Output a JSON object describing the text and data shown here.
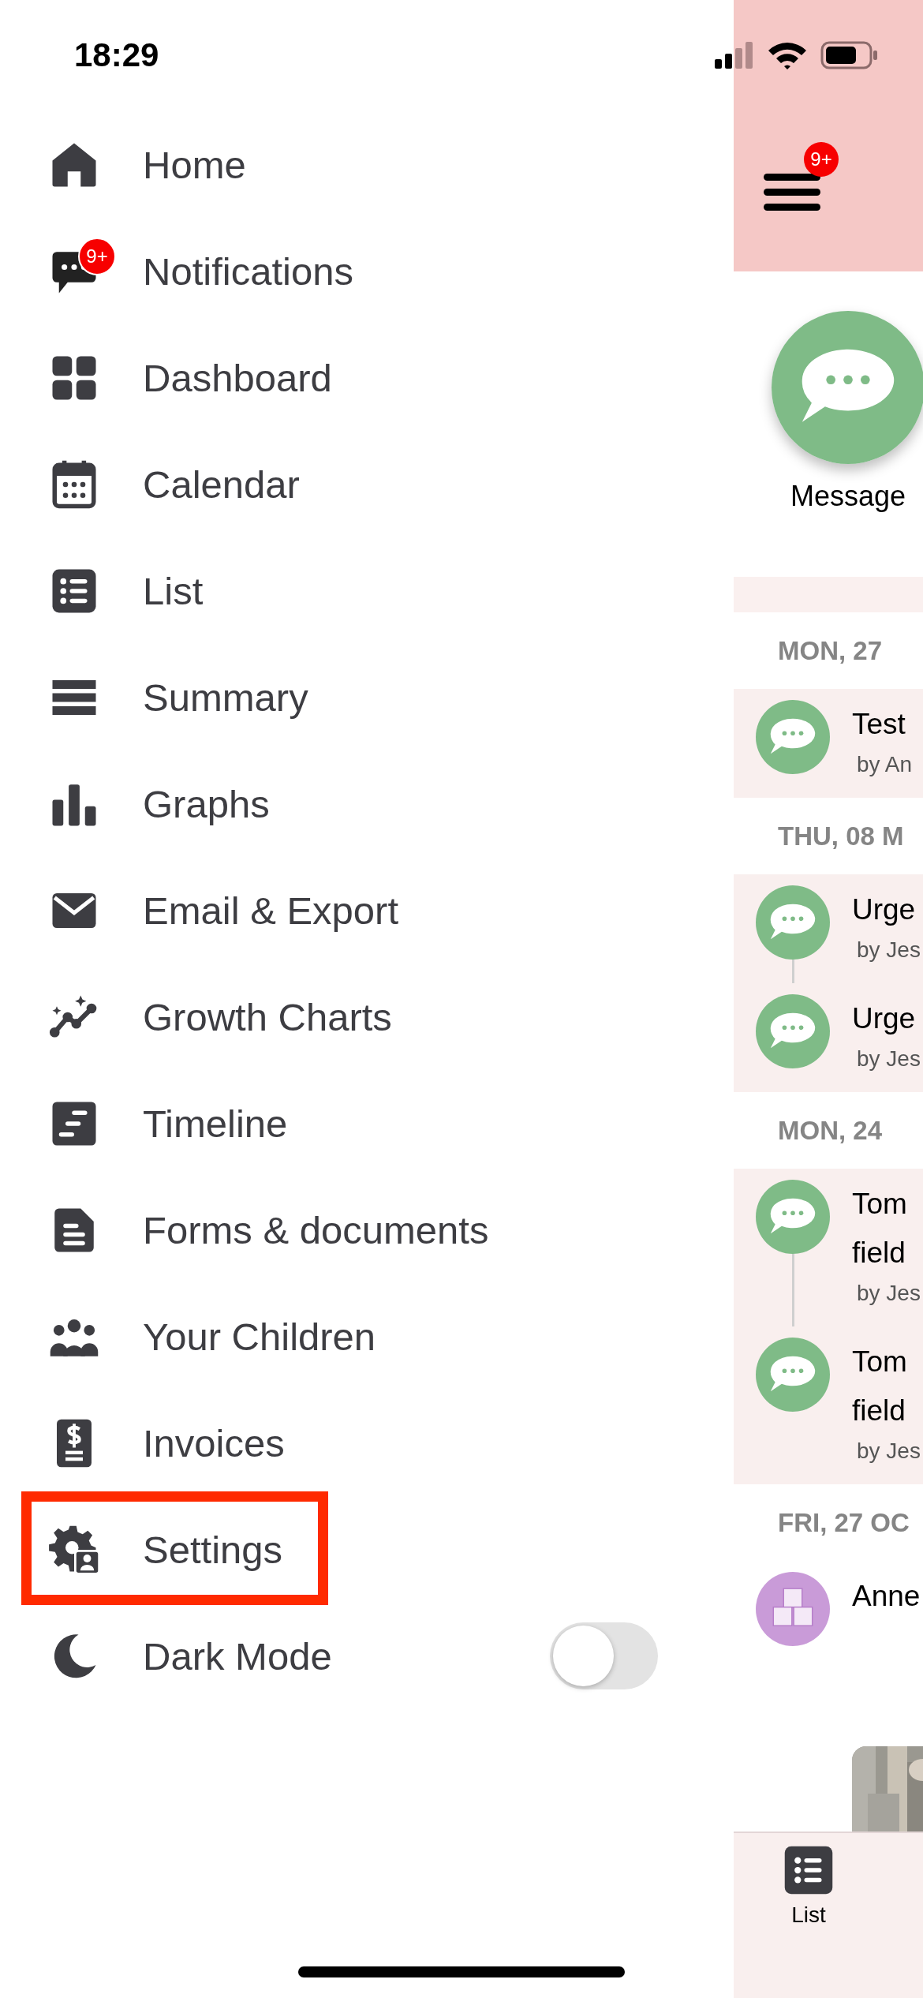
{
  "status_bar": {
    "time": "18:29"
  },
  "drawer": {
    "items": [
      {
        "kind": "home",
        "label": "Home",
        "annotated": false
      },
      {
        "kind": "chat",
        "label": "Notifications",
        "badge": "9+",
        "annotated": false
      },
      {
        "kind": "grid",
        "label": "Dashboard",
        "annotated": false
      },
      {
        "kind": "calendar",
        "label": "Calendar",
        "annotated": false
      },
      {
        "kind": "list",
        "label": "List",
        "annotated": false
      },
      {
        "kind": "summary",
        "label": "Summary",
        "annotated": false
      },
      {
        "kind": "graphs",
        "label": "Graphs",
        "annotated": false
      },
      {
        "kind": "mail",
        "label": "Email & Export",
        "annotated": false
      },
      {
        "kind": "growth",
        "label": "Growth Charts",
        "annotated": false
      },
      {
        "kind": "timeline",
        "label": "Timeline",
        "annotated": false
      },
      {
        "kind": "document",
        "label": "Forms & documents",
        "annotated": false
      },
      {
        "kind": "people",
        "label": "Your Children",
        "annotated": false
      },
      {
        "kind": "invoice",
        "label": "Invoices",
        "annotated": false
      },
      {
        "kind": "settings",
        "label": "Settings",
        "annotated": true
      }
    ],
    "dark_mode": {
      "label": "Dark Mode",
      "on": false
    }
  },
  "main": {
    "menu_badge": "9+",
    "action": {
      "label": "Message"
    },
    "feed": [
      {
        "date": "MON, 27",
        "shaded": true,
        "entries": [
          {
            "kind": "message",
            "title_lines": [
              "Test"
            ],
            "byline": "by An"
          }
        ]
      },
      {
        "date": "THU, 08 M",
        "shaded": true,
        "entries": [
          {
            "kind": "message",
            "title_lines": [
              "Urge"
            ],
            "byline": "by Jes"
          },
          {
            "kind": "message",
            "title_lines": [
              "Urge"
            ],
            "byline": "by Jes"
          }
        ]
      },
      {
        "date": "MON, 24",
        "shaded": true,
        "entries": [
          {
            "kind": "message",
            "title_lines": [
              "Tom",
              "field"
            ],
            "byline": "by Jes"
          },
          {
            "kind": "message",
            "title_lines": [
              "Tom",
              "field"
            ],
            "byline": "by Jes"
          }
        ]
      },
      {
        "date": "FRI, 27 OC",
        "shaded": false,
        "entries": [
          {
            "kind": "blocks",
            "title_lines": [
              "Anne"
            ]
          }
        ]
      }
    ],
    "tabs": [
      {
        "label": "List"
      }
    ]
  }
}
